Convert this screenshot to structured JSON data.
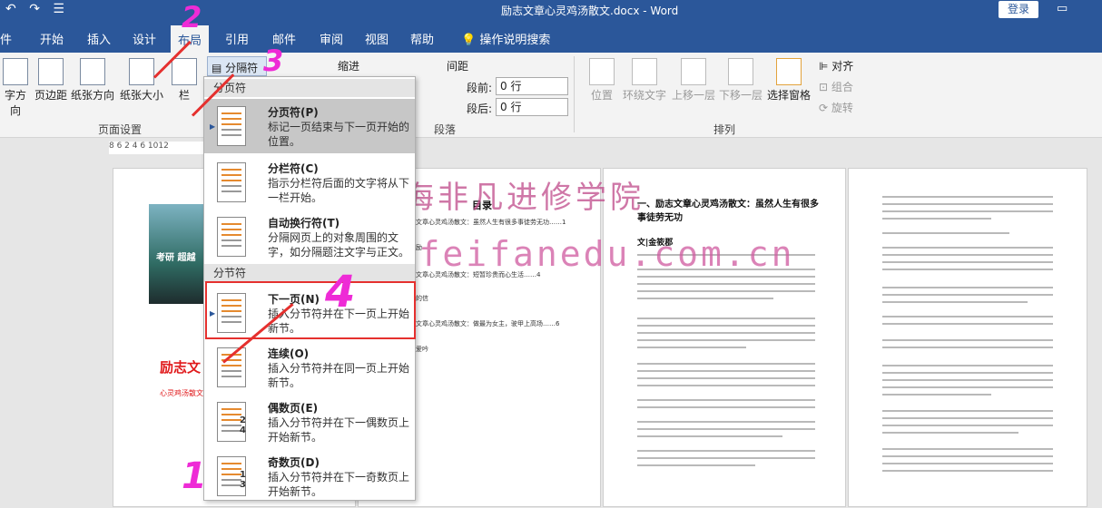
{
  "titlebar": {
    "title": "励志文章心灵鸡汤散文.docx - Word",
    "login": "登录",
    "undo": "↶",
    "redo": "↷",
    "save": "☰",
    "window_controls": "▭"
  },
  "tabs": [
    "件",
    "开始",
    "插入",
    "设计",
    "布局",
    "引用",
    "邮件",
    "审阅",
    "视图",
    "帮助"
  ],
  "tell_me": "操作说明搜索",
  "ribbon": {
    "page_setup": {
      "buttons": [
        "字方向",
        "页边距",
        "纸张方向",
        "纸张大小",
        "栏"
      ],
      "label": "页面设置",
      "breaks_label": "分隔符",
      "breaks_arrow": "▾"
    },
    "paragraph": {
      "indent": "缩进",
      "spacing": "间距",
      "before_label": "段前:",
      "before_value": "0 行",
      "after_label": "段后:",
      "after_value": "0 行",
      "label": "段落"
    },
    "arrange": {
      "buttons": [
        "位置",
        "环绕文字",
        "上移一层",
        "下移一层",
        "选择窗格"
      ],
      "align": "对齐",
      "group": "组合",
      "rotate": "旋转",
      "label": "排列"
    }
  },
  "ruler": "8 6  2   4 6  1012",
  "menu": {
    "page_breaks_header": "分页符",
    "section_breaks_header": "分节符",
    "items": [
      {
        "title": "分页符(P)",
        "desc": "标记一页结束与下一页开始的位置。"
      },
      {
        "title": "分栏符(C)",
        "desc": "指示分栏符后面的文字将从下一栏开始。"
      },
      {
        "title": "自动换行符(T)",
        "desc": "分隔网页上的对象周围的文字，如分隔题注文字与正文。"
      },
      {
        "title": "下一页(N)",
        "desc": "插入分节符并在下一页上开始新节。"
      },
      {
        "title": "连续(O)",
        "desc": "插入分节符并在同一页上开始新节。"
      },
      {
        "title": "偶数页(E)",
        "desc": "插入分节符并在下一偶数页上开始新节。",
        "icon_num": "2 4"
      },
      {
        "title": "奇数页(D)",
        "desc": "插入分节符并在下一奇数页上开始新节。",
        "icon_num": "1 3"
      }
    ]
  },
  "document": {
    "cover_title": "励志文",
    "cover_sub": "心灵鸡汤散文",
    "cover_img_text": "考研 超越",
    "toc_header": "目录",
    "toc": [
      "文章心灵鸡汤散文：虽然人生有很多事徒劳无功……1",
      "励",
      "文章心灵鸡汤散文：短暂珍贵而心生活……4",
      "的信",
      "文章心灵鸡汤散文：做最为女主，驶甲上高场……6",
      "爱吟"
    ],
    "page3_title": "一、励志文章心灵鸡汤散文：虽然人生有很多事徒劳无功",
    "page3_sub": "文|金筱郡"
  },
  "watermark": {
    "cn": "上海非凡进修学院",
    "url": "www.feifanedu.com.cn"
  },
  "annotations": {
    "n1": "1",
    "n2": "2",
    "n3": "3",
    "n4": "4"
  }
}
